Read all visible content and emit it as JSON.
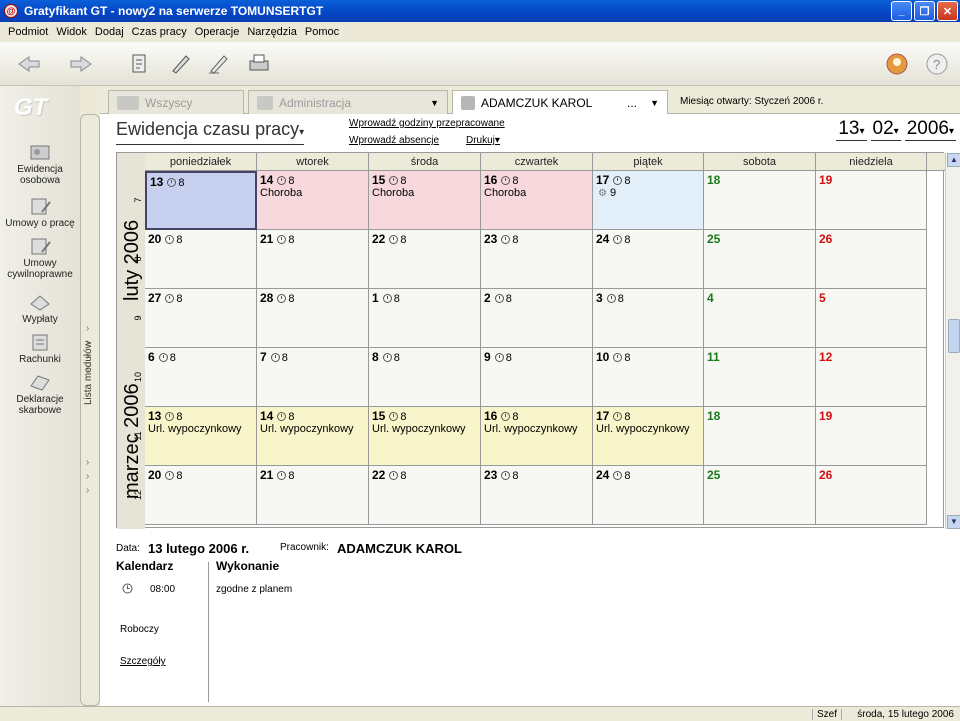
{
  "window": {
    "title": "Gratyfikant GT - nowy2 na serwerze TOMUNSERTGT"
  },
  "menu": [
    "Podmiot",
    "Widok",
    "Dodaj",
    "Czas pracy",
    "Operacje",
    "Narzędzia",
    "Pomoc"
  ],
  "nav": {
    "logo": "GT",
    "items": [
      "Ewidencja osobowa",
      "Umowy o pracę",
      "Umowy cywilnoprawne",
      "Wypłaty",
      "Rachunki",
      "Deklaracje skarbowe"
    ],
    "modules_label": "Lista modułów"
  },
  "tabs": [
    "Wszyscy",
    "Administracja",
    "ADAMCZUK KAROL"
  ],
  "tabs_ellipsis": "...",
  "month_open": "Miesiąc otwarty: Styczeń 2006 r.",
  "title": "Ewidencja czasu pracy",
  "links": {
    "hours": "Wprowadź godziny przepracowane",
    "absence": "Wprowadź absencje",
    "print": "Drukuj"
  },
  "date": {
    "day": "13",
    "month": "02",
    "year": "2006"
  },
  "weekdays": [
    "poniedziałek",
    "wtorek",
    "środa",
    "czwartek",
    "piątek",
    "sobota",
    "niedziela"
  ],
  "months": [
    "luty 2006",
    "marzec 2006"
  ],
  "weeks": [
    "7",
    "8",
    "9",
    "10",
    "11",
    "12"
  ],
  "rows": [
    [
      {
        "d": "13",
        "h": "8"
      },
      {
        "d": "14",
        "h": "8",
        "n": "Choroba"
      },
      {
        "d": "15",
        "h": "8",
        "n": "Choroba"
      },
      {
        "d": "16",
        "h": "8",
        "n": "Choroba"
      },
      {
        "d": "17",
        "h": "8",
        "h2": "9"
      },
      {
        "d": "18"
      },
      {
        "d": "19"
      }
    ],
    [
      {
        "d": "20",
        "h": "8"
      },
      {
        "d": "21",
        "h": "8"
      },
      {
        "d": "22",
        "h": "8"
      },
      {
        "d": "23",
        "h": "8"
      },
      {
        "d": "24",
        "h": "8"
      },
      {
        "d": "25"
      },
      {
        "d": "26"
      }
    ],
    [
      {
        "d": "27",
        "h": "8"
      },
      {
        "d": "28",
        "h": "8"
      },
      {
        "d": "1",
        "h": "8"
      },
      {
        "d": "2",
        "h": "8"
      },
      {
        "d": "3",
        "h": "8"
      },
      {
        "d": "4"
      },
      {
        "d": "5"
      }
    ],
    [
      {
        "d": "6",
        "h": "8"
      },
      {
        "d": "7",
        "h": "8"
      },
      {
        "d": "8",
        "h": "8"
      },
      {
        "d": "9",
        "h": "8"
      },
      {
        "d": "10",
        "h": "8"
      },
      {
        "d": "11"
      },
      {
        "d": "12"
      }
    ],
    [
      {
        "d": "13",
        "h": "8",
        "n": "Url. wypoczynkowy"
      },
      {
        "d": "14",
        "h": "8",
        "n": "Url. wypoczynkowy"
      },
      {
        "d": "15",
        "h": "8",
        "n": "Url. wypoczynkowy"
      },
      {
        "d": "16",
        "h": "8",
        "n": "Url. wypoczynkowy"
      },
      {
        "d": "17",
        "h": "8",
        "n": "Url. wypoczynkowy"
      },
      {
        "d": "18"
      },
      {
        "d": "19"
      }
    ],
    [
      {
        "d": "20",
        "h": "8"
      },
      {
        "d": "21",
        "h": "8"
      },
      {
        "d": "22",
        "h": "8"
      },
      {
        "d": "23",
        "h": "8"
      },
      {
        "d": "24",
        "h": "8"
      },
      {
        "d": "25"
      },
      {
        "d": "26"
      }
    ]
  ],
  "detail": {
    "data_label": "Data:",
    "data_value": "13 lutego 2006 r.",
    "worker_label": "Pracownik:",
    "worker_value": "ADAMCZUK KAROL",
    "calendar": "Kalendarz",
    "execution": "Wykonanie",
    "time": "08:00",
    "status": "zgodne z planem",
    "type": "Roboczy",
    "details": "Szczegóły"
  },
  "status": {
    "user": "Szef",
    "date": "środa, 15 lutego 2006"
  }
}
